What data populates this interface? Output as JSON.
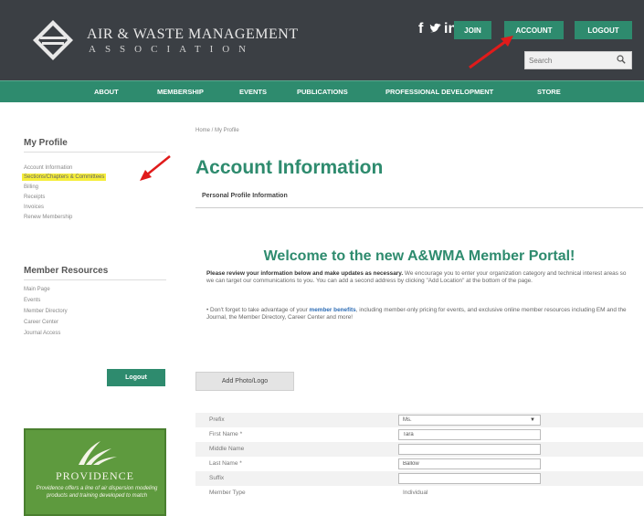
{
  "header": {
    "org_name": "AIR & WASTE MANAGEMENT",
    "org_sub": "ASSOCIATION",
    "social": [
      "facebook-icon",
      "twitter-icon",
      "linkedin-icon"
    ],
    "buttons": {
      "join": "JOIN",
      "account": "ACCOUNT",
      "logout": "LOGOUT"
    },
    "search_placeholder": "Search"
  },
  "nav": [
    "ABOUT",
    "MEMBERSHIP",
    "EVENTS",
    "PUBLICATIONS",
    "PROFESSIONAL DEVELOPMENT",
    "STORE"
  ],
  "sidebar": {
    "profile_title": "My Profile",
    "profile_links": [
      "Account Information",
      "Sections/Chapters & Committees",
      "Billing",
      "Receipts",
      "Invoices",
      "Renew Membership"
    ],
    "resources_title": "Member Resources",
    "resources_links": [
      "Main Page",
      "Events",
      "Member Directory",
      "Career Center",
      "Journal Access"
    ],
    "logout_label": "Logout"
  },
  "ad": {
    "brand": "PROVIDENCE",
    "text": "Providence offers a line of air dispersion modeling products and training developed to match"
  },
  "main": {
    "breadcrumb": "Home / My Profile",
    "title": "Account Information",
    "tab": "Personal Profile Information",
    "welcome": "Welcome to the new A&WMA Member Portal!",
    "para1_bold": "Please review your information below and make updates as necessary.",
    "para1_rest": " We encourage you to enter your organization category and technical interest areas so we can target our communications to you. You can add a second address by clicking \"Add Location\" at the bottom of the page.",
    "para2_pre": "• Don't forget to take advantage of your ",
    "para2_link": "member benefits",
    "para2_rest": ", including member-only pricing for events, and exclusive online member resources including EM and the Journal, the Member Directory, Career Center and more!",
    "photo_button": "Add Photo/Logo"
  },
  "form": {
    "prefix_label": "Prefix",
    "prefix_value": "Ms.",
    "first_label": "First Name *",
    "first_value": "Tara",
    "middle_label": "Middle Name",
    "middle_value": "",
    "last_label": "Last Name *",
    "last_value": "Ballow",
    "suffix_label": "Suffix",
    "suffix_value": "",
    "type_label": "Member Type",
    "type_value": "Individual"
  },
  "colors": {
    "header": "#3b3f44",
    "accent": "#2e8b6e",
    "highlight": "#f6ee3a",
    "annotation": "#e01b1b"
  }
}
